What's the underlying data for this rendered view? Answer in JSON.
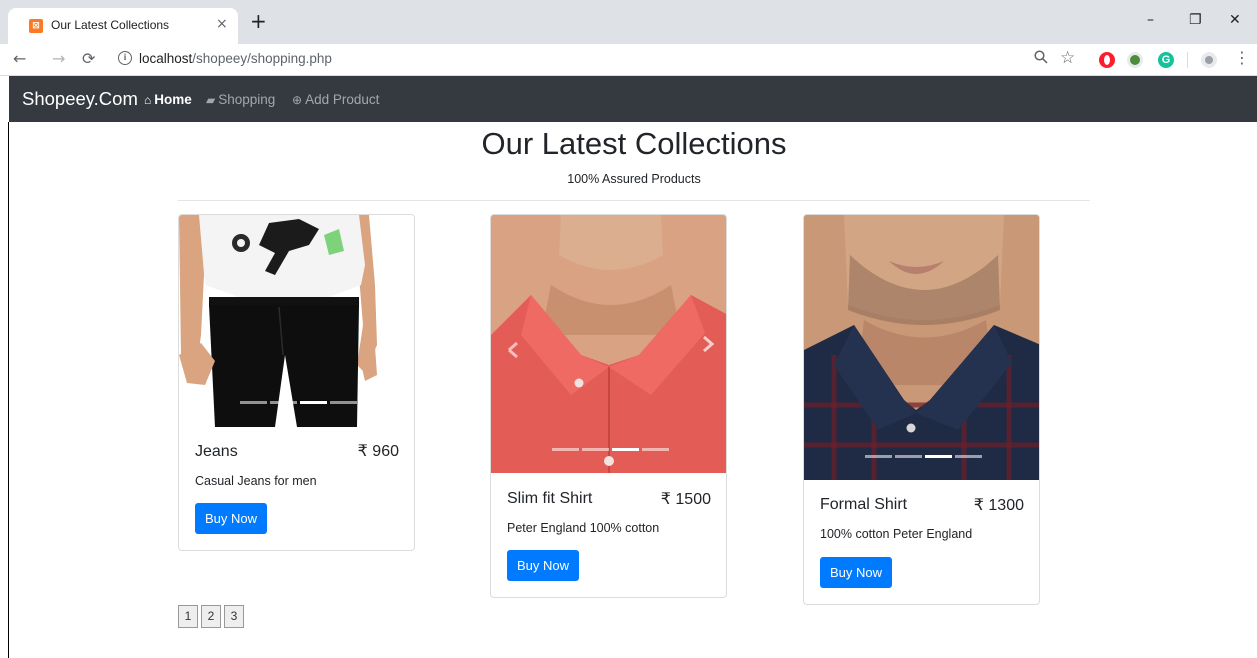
{
  "browser": {
    "tab_title": "Our Latest Collections",
    "tab_close": "×",
    "new_tab": "+",
    "url_host": "localhost",
    "url_path": "/shopeey/shopping.php",
    "controls": {
      "minimize": "–",
      "restore": "❐",
      "close": "✕"
    }
  },
  "navbar": {
    "brand": "Shopeey.Com",
    "links": [
      {
        "icon": "home-icon",
        "label": "Home",
        "active": true
      },
      {
        "icon": "shopping-bag-icon",
        "label": "Shopping",
        "active": false
      },
      {
        "icon": "plus-circle-icon",
        "label": "Add Product",
        "active": false
      }
    ],
    "background": "#343a40"
  },
  "page": {
    "title": "Our Latest Collections",
    "subtitle": "100% Assured Products"
  },
  "products": [
    {
      "name": "Jeans",
      "price": "₹ 960",
      "description": "Casual Jeans for men",
      "button": "Buy Now",
      "image": "jeans-photo",
      "active_slide": 3,
      "slides": 4
    },
    {
      "name": "Slim fit Shirt",
      "price": "₹ 1500",
      "description": "Peter England 100% cotton",
      "button": "Buy Now",
      "image": "red-shirt-photo",
      "active_slide": 3,
      "slides": 4
    },
    {
      "name": "Formal Shirt",
      "price": "₹ 1300",
      "description": "100% cotton Peter England",
      "button": "Buy Now",
      "image": "checked-shirt-photo",
      "active_slide": 3,
      "slides": 4
    }
  ],
  "pagination": [
    "1",
    "2",
    "3"
  ],
  "colors": {
    "accent": "#007bff"
  }
}
